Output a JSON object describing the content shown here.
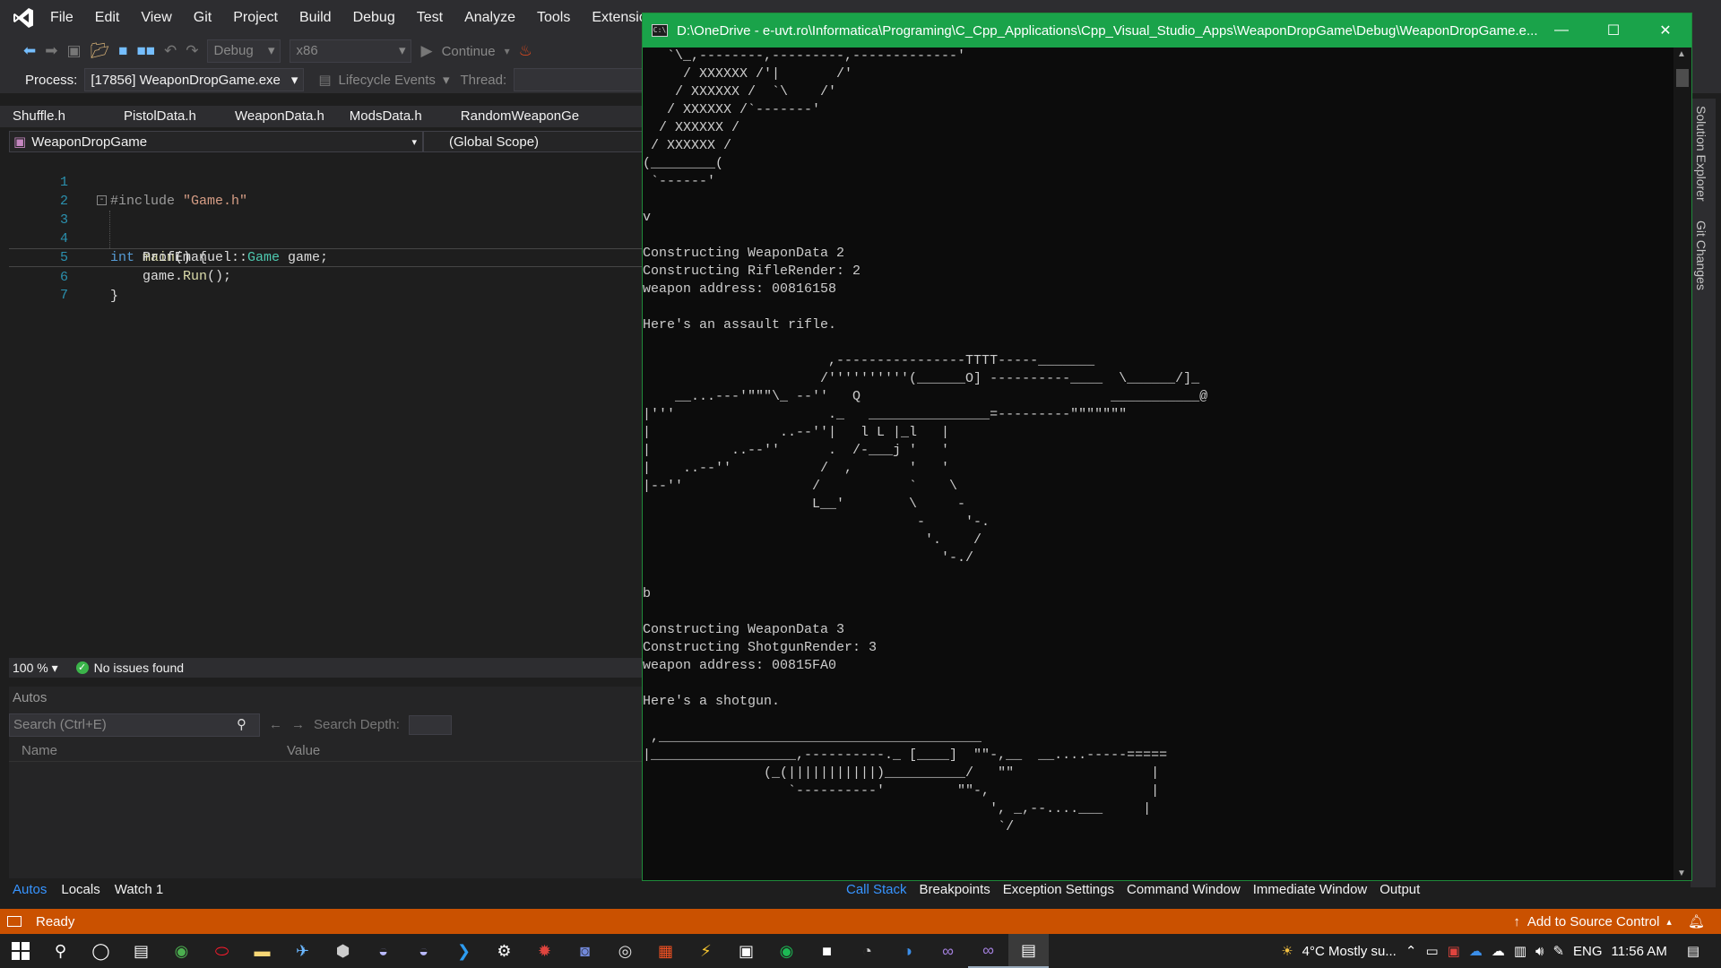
{
  "menubar": {
    "items": [
      "File",
      "Edit",
      "View",
      "Git",
      "Project",
      "Build",
      "Debug",
      "Test",
      "Analyze",
      "Tools",
      "Extensions"
    ]
  },
  "toolbar": {
    "config": "Debug",
    "platform": "x86",
    "continue_label": "Continue"
  },
  "procbar": {
    "process_label": "Process:",
    "process_value": "[17856] WeaponDropGame.exe",
    "lifecycle_label": "Lifecycle Events",
    "thread_label": "Thread:"
  },
  "doc_tabs": [
    "Shuffle.h",
    "PistolData.h",
    "WeaponData.h",
    "ModsData.h",
    "RandomWeaponGe"
  ],
  "navbar": {
    "project": "WeaponDropGame",
    "scope": "(Global Scope)"
  },
  "editor": {
    "line_numbers": [
      "1",
      "2",
      "3",
      "4",
      "5",
      "6",
      "7"
    ],
    "include_directive": "#include",
    "include_file": "\"Game.h\"",
    "kw_int": "int",
    "fn_main": "main",
    "main_rest": "() {",
    "ns": "ProfEmanuel::",
    "type_game": "Game",
    "var_decl": " game;",
    "call_obj": "game.",
    "call_fn": "Run",
    "call_rest": "();",
    "close_brace": "}"
  },
  "editor_status": {
    "zoom": "100 %",
    "issues": "No issues found"
  },
  "autos": {
    "title": "Autos",
    "search_placeholder": "Search (Ctrl+E)",
    "search_depth_label": "Search Depth:",
    "col_name": "Name",
    "col_value": "Value"
  },
  "bottom_tabs_left": [
    "Autos",
    "Locals",
    "Watch 1"
  ],
  "bottom_tabs_right": [
    "Call Stack",
    "Breakpoints",
    "Exception Settings",
    "Command Window",
    "Immediate Window",
    "Output"
  ],
  "sidebar_right": [
    "Solution Explorer",
    "Git Changes"
  ],
  "statusbar": {
    "state": "Ready",
    "source_control": "Add to Source Control"
  },
  "console": {
    "title": "D:\\OneDrive - e-uvt.ro\\Informatica\\Programing\\C_Cpp_Applications\\Cpp_Visual_Studio_Apps\\WeaponDropGame\\Debug\\WeaponDropGame.e...",
    "output": "   `\\_,--------,---------,-------------'\n     / XXXXXX /'|       /'\n    / XXXXXX /  `\\    /'\n   / XXXXXX /`-------'\n  / XXXXXX /\n / XXXXXX /\n(________(\n `------'\n\nv\n\nConstructing WeaponData 2\nConstructing RifleRender: 2\nweapon address: 00816158\n\nHere's an assault rifle.\n\n                       ,----------------TTTT-----_______\n                      /''''''''''(______O] ----------____  \\______/]_\n    __...---'\"\"\"\\_ --''   Q                               ___________@\n|'''                   ._   _______________=---------\"\"\"\"\"\"\"\n|                ..--''|   l L |_l   |\n|          ..--''      .  /-___j '   '\n|    ..--''           /  ,       '   '\n|--''                /           `    \\\n                     L__'        \\     -\n                                  -     '-.\n                                   '.    /\n                                     '-./\n\nb\n\nConstructing WeaponData 3\nConstructing ShotgunRender: 3\nweapon address: 00815FA0\n\nHere's a shotgun.\n\n ,________________________________________\n|__________________,----------._ [____]  \"\"-,__  __....-----=====\n               (_(|||||||||||)__________/   \"\"                 |\n                  `----------'         \"\"-,                    |\n                                           ', _,--....___     |\n                                            `/\n\n\n▬"
  },
  "taskbar": {
    "weather": "4°C  Mostly su...",
    "lang": "ENG",
    "time": "11:56 AM"
  },
  "colors": {
    "vs_bg": "#1e1e1e",
    "status_orange": "#ca5100",
    "console_title_green": "#1aa34a",
    "accent_blue": "#3794ff"
  }
}
